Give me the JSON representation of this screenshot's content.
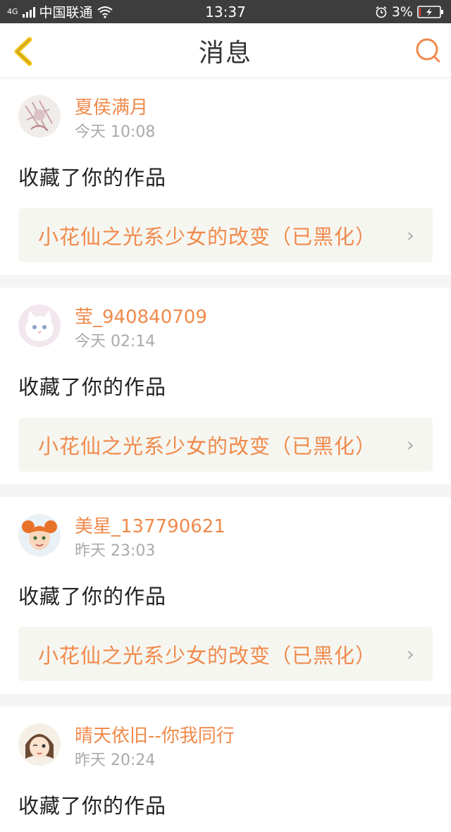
{
  "status": {
    "carrier": "中国联通",
    "network": "4G",
    "time": "13:37",
    "battery": "3%"
  },
  "header": {
    "title": "消息"
  },
  "messages": [
    {
      "username": "夏侯满月",
      "time": "今天 10:08",
      "action": "收藏了你的作品",
      "work": "小花仙之光系少女的改变（已黑化）"
    },
    {
      "username": "莹_940840709",
      "time": "今天 02:14",
      "action": "收藏了你的作品",
      "work": "小花仙之光系少女的改变（已黑化）"
    },
    {
      "username": "美星_137790621",
      "time": "昨天 23:03",
      "action": "收藏了你的作品",
      "work": "小花仙之光系少女的改变（已黑化）"
    },
    {
      "username": "晴天依旧--你我同行",
      "time": "昨天 20:24",
      "action": "收藏了你的作品"
    }
  ],
  "colors": {
    "accent": "#f08a4b",
    "back_icon": "#f5c518"
  }
}
